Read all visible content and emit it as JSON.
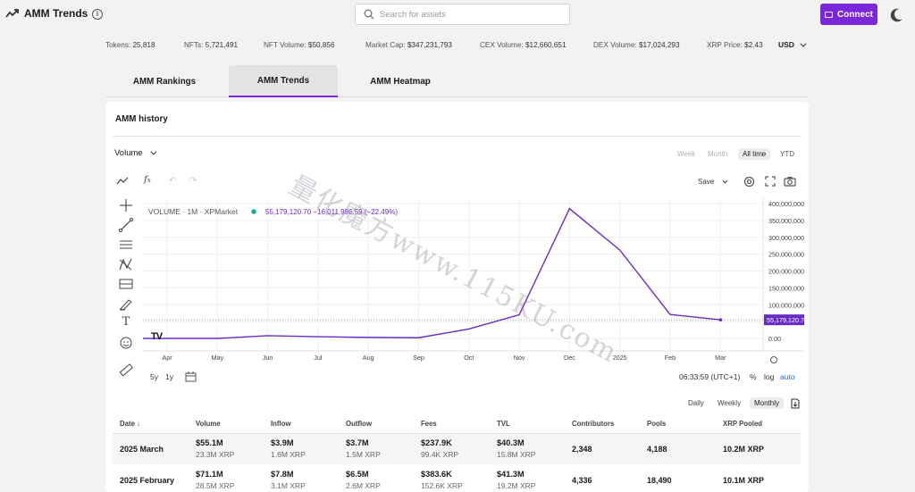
{
  "app": {
    "title": "AMM Trends"
  },
  "search": {
    "placeholder": "Search for assets"
  },
  "connect_label": "Connect",
  "stats": [
    {
      "label": "Tokens:",
      "value": "25,818"
    },
    {
      "label": "NFTs:",
      "value": "5,721,491"
    },
    {
      "label": "NFT Volume:",
      "value": "$50,856"
    },
    {
      "label": "Market Cap:",
      "value": "$347,231,793"
    },
    {
      "label": "CEX Volume:",
      "value": "$12,660,651"
    },
    {
      "label": "DEX Volume:",
      "value": "$17,024,293"
    },
    {
      "label": "XRP Price:",
      "value": "$2.43"
    }
  ],
  "currency": "USD",
  "tabs": [
    {
      "label": "AMM Rankings"
    },
    {
      "label": "AMM Trends",
      "active": true
    },
    {
      "label": "AMM Heatmap"
    }
  ],
  "panel": {
    "title": "AMM history",
    "metric": "Volume",
    "ranges": [
      "Week",
      "Month",
      "All time",
      "YTD"
    ],
    "active_range": "All time",
    "save_label": "Save",
    "chart_legend": {
      "symbol": "VOLUME · 1M · XPMarket",
      "last_value": "55,179,120.70",
      "change": "−16,011,996.59 (−22.49%)"
    },
    "bottom_ranges": [
      "5y",
      "1y"
    ],
    "time": "06:33:59 (UTC+1)",
    "scale_options": [
      "%",
      "log",
      "auto"
    ],
    "frequency": [
      "Daily",
      "Weekly",
      "Monthly"
    ],
    "active_frequency": "Monthly"
  },
  "chart_data": {
    "type": "line",
    "x": [
      "Apr",
      "May",
      "Jun",
      "Jul",
      "Aug",
      "Sep",
      "Oct",
      "Nov",
      "Dec",
      "2025",
      "Feb",
      "Mar"
    ],
    "series": [
      {
        "values": [
          0,
          0,
          8000000,
          5000000,
          3000000,
          2000000,
          28000000,
          70000000,
          385000000,
          262000000,
          71100000,
          55179120.7
        ]
      }
    ],
    "y_ticks": [
      "400,000,000.00",
      "350,000,000.00",
      "300,000,000.00",
      "250,000,000.00",
      "200,000,000.00",
      "150,000,000.00",
      "100,000,000.00",
      "50,000,000.00",
      "0.00"
    ],
    "ylim": [
      0,
      400000000
    ],
    "last_label": "55,179,120.70",
    "line_color": "#6a2bc4",
    "grid": true
  },
  "table": {
    "headers": [
      "Date",
      "Volume",
      "Inflow",
      "Outflow",
      "Fees",
      "TVL",
      "Contributors",
      "Pools",
      "XRP Pooled"
    ],
    "rows": [
      {
        "date": "2025 March",
        "volume": {
          "usd": "$55.1M",
          "xrp": "23.3M XRP"
        },
        "inflow": {
          "usd": "$3.9M",
          "xrp": "1.6M XRP"
        },
        "outflow": {
          "usd": "$3.7M",
          "xrp": "1.5M XRP"
        },
        "fees": {
          "usd": "$237.9K",
          "xrp": "99.4K XRP"
        },
        "tvl": {
          "usd": "$40.3M",
          "xrp": "15.8M XRP"
        },
        "contributors": "2,348",
        "pools": "4,188",
        "xrp_pooled": "10.2M XRP"
      },
      {
        "date": "2025 February",
        "volume": {
          "usd": "$71.1M",
          "xrp": "28.5M XRP"
        },
        "inflow": {
          "usd": "$7.8M",
          "xrp": "3.1M XRP"
        },
        "outflow": {
          "usd": "$6.5M",
          "xrp": "2.6M XRP"
        },
        "fees": {
          "usd": "$383.6K",
          "xrp": "152.6K XRP"
        },
        "tvl": {
          "usd": "$41.3M",
          "xrp": "19.2M XRP"
        },
        "contributors": "4,336",
        "pools": "18,490",
        "xrp_pooled": "10.1M XRP"
      }
    ]
  },
  "watermark": "量化魔方www.115KU.com"
}
